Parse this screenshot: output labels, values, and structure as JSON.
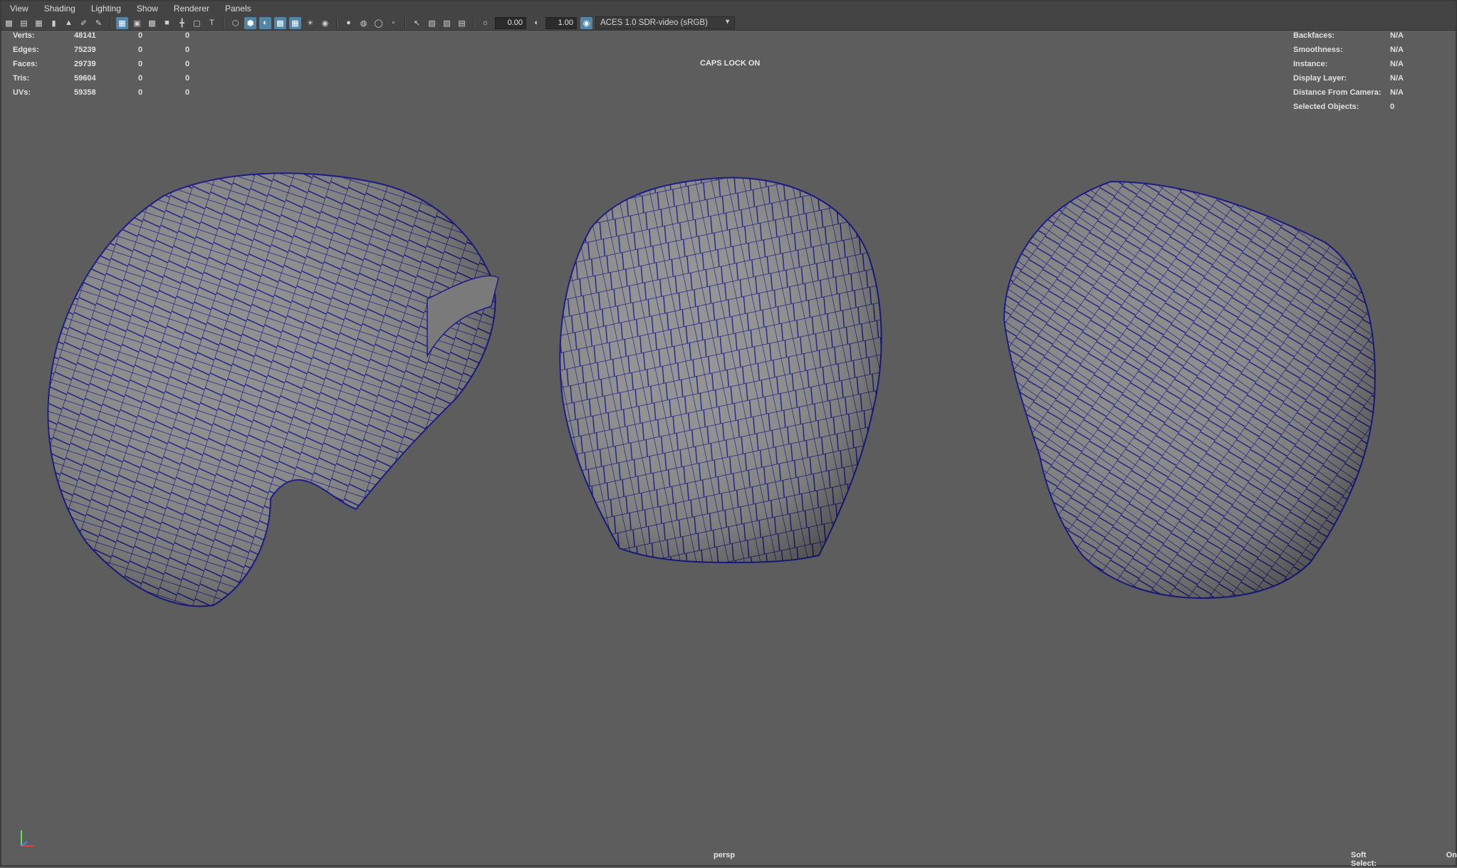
{
  "menu": [
    "View",
    "Shading",
    "Lighting",
    "Show",
    "Renderer",
    "Panels"
  ],
  "toolbar": {
    "exposure": "0.00",
    "gamma": "1.00",
    "color_space": "ACES 1.0 SDR-video (sRGB)"
  },
  "stats_left": [
    {
      "label": "Verts:",
      "v1": "48141",
      "v2": "0",
      "v3": "0"
    },
    {
      "label": "Edges:",
      "v1": "75239",
      "v2": "0",
      "v3": "0"
    },
    {
      "label": "Faces:",
      "v1": "29739",
      "v2": "0",
      "v3": "0"
    },
    {
      "label": "Tris:",
      "v1": "59604",
      "v2": "0",
      "v3": "0"
    },
    {
      "label": "UVs:",
      "v1": "59358",
      "v2": "0",
      "v3": "0"
    }
  ],
  "stats_right": [
    {
      "label": "Backfaces:",
      "value": "N/A"
    },
    {
      "label": "Smoothness:",
      "value": "N/A"
    },
    {
      "label": "Instance:",
      "value": "N/A"
    },
    {
      "label": "Display Layer:",
      "value": "N/A"
    },
    {
      "label": "Distance From Camera:",
      "value": "N/A"
    },
    {
      "label": "Selected Objects:",
      "value": "0"
    }
  ],
  "caps_lock": "CAPS LOCK ON",
  "camera": "persp",
  "soft_select": {
    "label": "Soft Select:",
    "value": "On"
  },
  "colors": {
    "viewport_bg": "#5d5d5d",
    "wireframe": "#1c1c8c",
    "mesh_fill": "#8f8f8f",
    "highlight": "#5285a6"
  }
}
